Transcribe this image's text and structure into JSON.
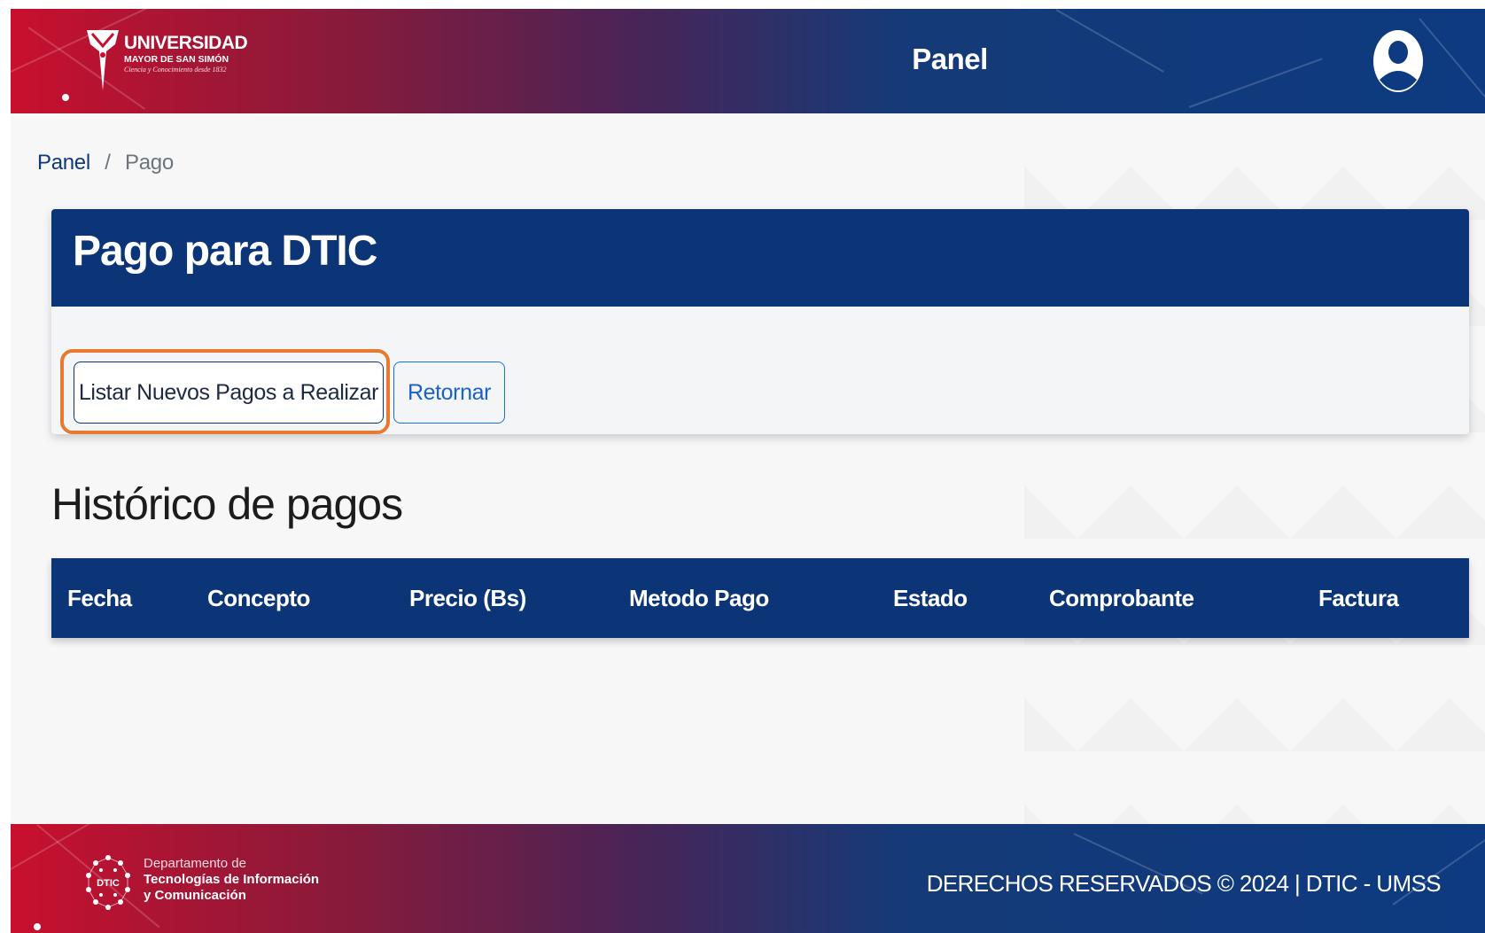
{
  "header": {
    "logo": {
      "line1": "UNIVERSIDAD",
      "line2": "MAYOR DE SAN SIMÓN",
      "tagline": "Ciencia y Conocimiento desde 1832"
    },
    "title": "Panel",
    "user_icon": "user-circle-icon"
  },
  "breadcrumb": {
    "home": "Panel",
    "separator": "/",
    "current": "Pago"
  },
  "card": {
    "title": "Pago para DTIC",
    "list_button": "Listar Nuevos Pagos a Realizar",
    "back_button": "Retornar"
  },
  "history": {
    "title": "Histórico de pagos",
    "columns": [
      "Fecha",
      "Concepto",
      "Precio (Bs)",
      "Metodo Pago",
      "Estado",
      "Comprobante",
      "Factura"
    ],
    "rows": []
  },
  "footer": {
    "dtic": {
      "line1": "Departamento de",
      "line2": "Tecnologías de Información",
      "line3": "y Comunicación",
      "badge": "DTIC"
    },
    "copyright": "DERECHOS RESERVADOS © 2024 | DTIC - UMSS"
  },
  "colors": {
    "brand_blue": "#0c3577",
    "brand_red": "#c8102e",
    "highlight_orange": "#e8792f"
  }
}
